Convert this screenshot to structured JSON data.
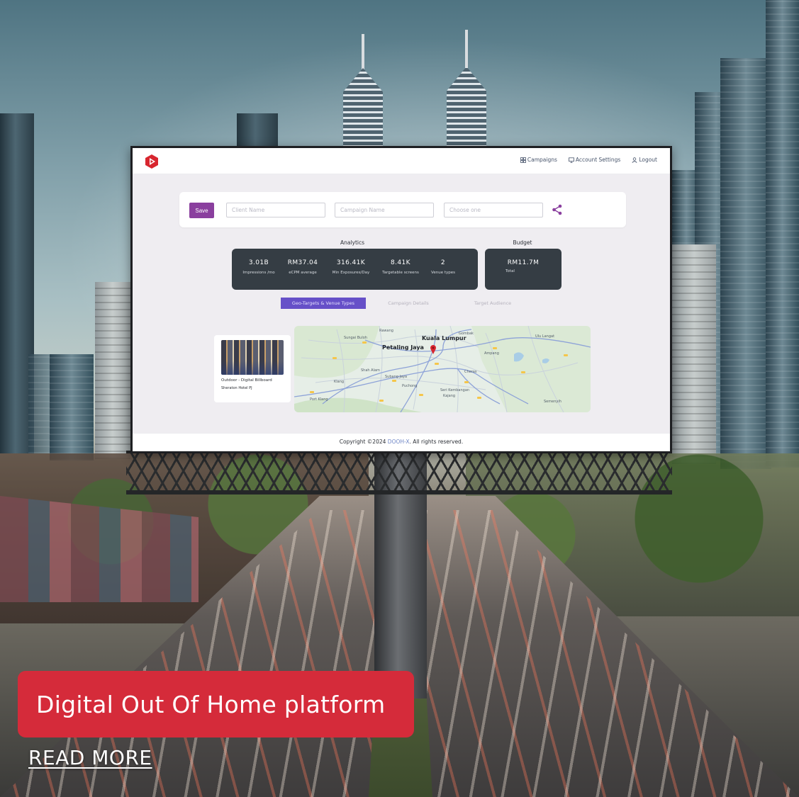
{
  "app": {
    "nav": [
      {
        "label": "Campaigns",
        "icon": "grid-icon"
      },
      {
        "label": "Account Settings",
        "icon": "monitor-icon"
      },
      {
        "label": "Logout",
        "icon": "user-icon"
      }
    ],
    "toolbar": {
      "save_label": "Save",
      "client_placeholder": "Client Name",
      "campaign_placeholder": "Campaign Name",
      "choose_placeholder": "Choose one",
      "share_icon": "share-icon"
    },
    "analytics": {
      "title": "Analytics",
      "stats": [
        {
          "value": "3.01B",
          "label": "Impressions /mo"
        },
        {
          "value": "RM37.04",
          "label": "eCPM average"
        },
        {
          "value": "316.41K",
          "label": "Min Exposures/Day"
        },
        {
          "value": "8.41K",
          "label": "Targetable screens"
        },
        {
          "value": "2",
          "label": "Venue types"
        }
      ]
    },
    "budget": {
      "title": "Budget",
      "value": "RM11.7M",
      "label": "Total"
    },
    "tabs": [
      {
        "label": "Geo-Targets & Venue Types",
        "active": true
      },
      {
        "label": "Campaign Details",
        "active": false
      },
      {
        "label": "Target Audience",
        "active": false
      }
    ],
    "venue": {
      "title": "Outdoor - Digital Billboard",
      "subtitle": "Sheraton Hotel PJ"
    },
    "map": {
      "labels": [
        "Kuala Lumpur",
        "Petaling Jaya",
        "Shah Alam",
        "Subang Jaya",
        "Puchong",
        "Klang",
        "Port Klang",
        "Cheras",
        "Kajang",
        "Ampang",
        "Semenyih",
        "Seri Kembangan",
        "Sungai Buloh",
        "Rawang",
        "Gombak",
        "Ulu Langat"
      ],
      "pin_color": "#d8262f"
    },
    "footer": {
      "prefix": "Copyright ©2024 ",
      "brand": "DOOH-X",
      "suffix": ". All rights reserved."
    },
    "colors": {
      "primary": "#8a3f9e",
      "tab_active": "#6650c8",
      "stats_bg": "#353d44",
      "logo": "#d8262f"
    }
  },
  "promo": {
    "headline": "Digital Out Of Home platform",
    "link": "READ MORE",
    "color": "#d52b3a"
  }
}
